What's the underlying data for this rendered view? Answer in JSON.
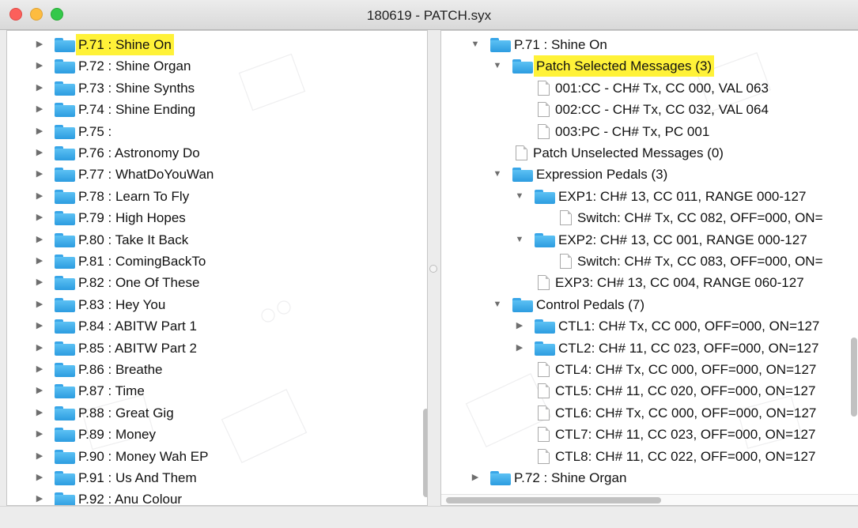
{
  "window": {
    "title": "180619 - PATCH.syx"
  },
  "left_tree": {
    "items": [
      {
        "id": "P.71",
        "name": "Shine On",
        "selected": true
      },
      {
        "id": "P.72",
        "name": "Shine Organ"
      },
      {
        "id": "P.73",
        "name": "Shine Synths"
      },
      {
        "id": "P.74",
        "name": "Shine Ending"
      },
      {
        "id": "P.75",
        "name": ""
      },
      {
        "id": "P.76",
        "name": "Astronomy Do"
      },
      {
        "id": "P.77",
        "name": "WhatDoYouWan"
      },
      {
        "id": "P.78",
        "name": "Learn To Fly"
      },
      {
        "id": "P.79",
        "name": "High Hopes"
      },
      {
        "id": "P.80",
        "name": "Take It Back"
      },
      {
        "id": "P.81",
        "name": "ComingBackTo"
      },
      {
        "id": "P.82",
        "name": "One Of These"
      },
      {
        "id": "P.83",
        "name": "Hey You"
      },
      {
        "id": "P.84",
        "name": "ABITW Part 1"
      },
      {
        "id": "P.85",
        "name": "ABITW Part 2"
      },
      {
        "id": "P.86",
        "name": "Breathe"
      },
      {
        "id": "P.87",
        "name": "Time"
      },
      {
        "id": "P.88",
        "name": "Great Gig"
      },
      {
        "id": "P.89",
        "name": "Money"
      },
      {
        "id": "P.90",
        "name": "Money Wah EP"
      },
      {
        "id": "P.91",
        "name": "Us And Them"
      },
      {
        "id": "P.92",
        "name": "Anu Colour"
      }
    ]
  },
  "right_tree": {
    "rows": [
      {
        "depth": 0,
        "kind": "folder",
        "arrow": "open",
        "text": "P.71  : Shine On"
      },
      {
        "depth": 1,
        "kind": "folder",
        "arrow": "open",
        "text": "Patch Selected Messages (3)",
        "selected": true
      },
      {
        "depth": 2,
        "kind": "file",
        "text": "001:CC - CH# Tx, CC 000, VAL 063"
      },
      {
        "depth": 2,
        "kind": "file",
        "text": "002:CC - CH# Tx, CC 032, VAL 064"
      },
      {
        "depth": 2,
        "kind": "file",
        "text": "003:PC - CH# Tx, PC 001"
      },
      {
        "depth": 1,
        "kind": "file",
        "text": "Patch Unselected Messages (0)"
      },
      {
        "depth": 1,
        "kind": "folder",
        "arrow": "open",
        "text": "Expression Pedals (3)"
      },
      {
        "depth": 2,
        "kind": "folder",
        "arrow": "open",
        "text": "EXP1: CH# 13, CC 011, RANGE 000-127"
      },
      {
        "depth": 3,
        "kind": "file",
        "text": "Switch: CH# Tx, CC 082, OFF=000, ON="
      },
      {
        "depth": 2,
        "kind": "folder",
        "arrow": "open",
        "text": "EXP2: CH# 13, CC 001, RANGE 000-127"
      },
      {
        "depth": 3,
        "kind": "file",
        "text": "Switch: CH# Tx, CC 083, OFF=000, ON="
      },
      {
        "depth": 2,
        "kind": "file",
        "text": "EXP3: CH# 13, CC 004, RANGE 060-127"
      },
      {
        "depth": 1,
        "kind": "folder",
        "arrow": "open",
        "text": "Control Pedals (7)"
      },
      {
        "depth": 2,
        "kind": "folder",
        "arrow": "closed",
        "text": "CTL1: CH# Tx, CC 000, OFF=000, ON=127"
      },
      {
        "depth": 2,
        "kind": "folder",
        "arrow": "closed",
        "text": "CTL2: CH# 11, CC 023, OFF=000, ON=127"
      },
      {
        "depth": 2,
        "kind": "file",
        "text": "CTL4: CH# Tx, CC 000, OFF=000, ON=127"
      },
      {
        "depth": 2,
        "kind": "file",
        "text": "CTL5: CH# 11, CC 020, OFF=000, ON=127"
      },
      {
        "depth": 2,
        "kind": "file",
        "text": "CTL6: CH# Tx, CC 000, OFF=000, ON=127"
      },
      {
        "depth": 2,
        "kind": "file",
        "text": "CTL7: CH# 11, CC 023, OFF=000, ON=127"
      },
      {
        "depth": 2,
        "kind": "file",
        "text": "CTL8: CH# 11, CC 022, OFF=000, ON=127"
      },
      {
        "depth": 0,
        "kind": "folder",
        "arrow": "closed",
        "text": "P.72  : Shine Organ"
      }
    ]
  },
  "icons": {
    "expand": "triangle-right-icon",
    "collapse": "triangle-down-icon",
    "folder": "folder-icon",
    "document": "document-icon"
  },
  "colors": {
    "selection": "#fff238",
    "folder": "#3aa9ec"
  }
}
